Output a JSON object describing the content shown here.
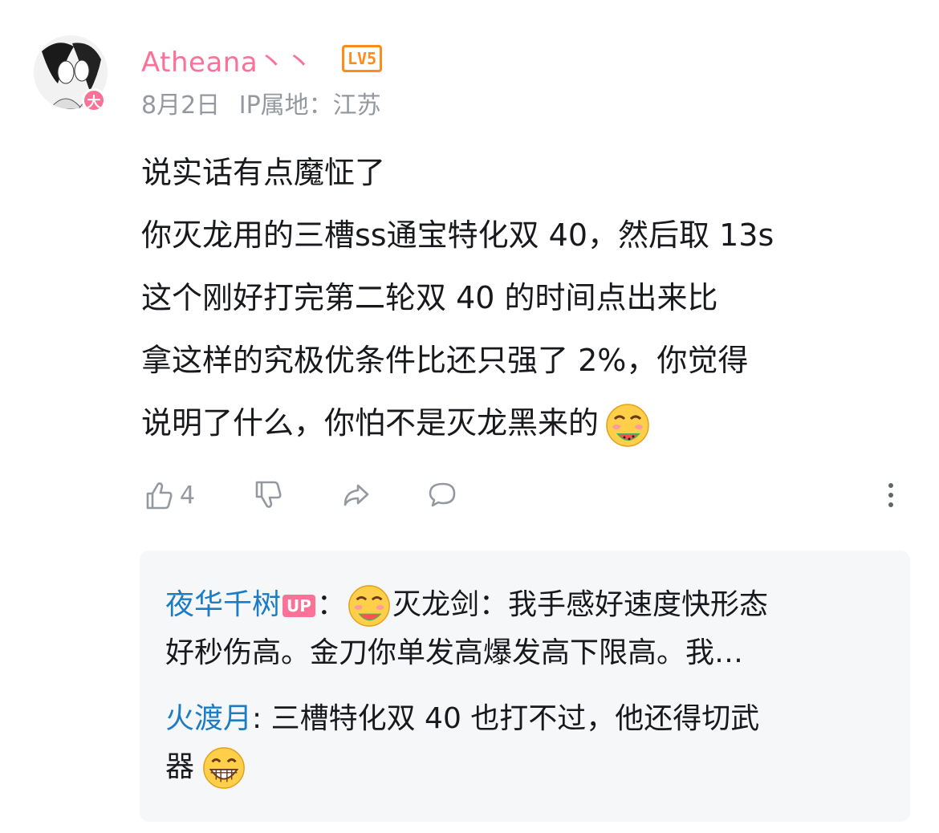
{
  "comment": {
    "user": {
      "name": "Atheana丶丶",
      "level_badge": "LV5",
      "avatar_badge": "大",
      "name_color": "#fb7299"
    },
    "date": "8月2日",
    "ip_location": "IP属地：江苏",
    "body_lines": [
      "说实话有点魔怔了",
      "你灭龙用的三槽ss通宝特化双 40，然后取 13s",
      "这个刚好打完第二轮双 40 的时间点出来比",
      "拿这样的究极优条件比还只强了 2%，你觉得",
      "说明了什么，你怕不是灭龙黑来的"
    ],
    "body_emoji": "watermelon-eating-emoji",
    "actions": {
      "like_count": "4",
      "like_icon": "thumbs-up-icon",
      "dislike_icon": "thumbs-down-icon",
      "share_icon": "share-icon",
      "reply_icon": "comment-bubble-icon",
      "more_icon": "more-vertical-icon"
    }
  },
  "replies": [
    {
      "user": "夜华千树",
      "tag": "UP",
      "separator": "：",
      "emoji": "watermelon-eating-emoji",
      "text_line1": "灭龙剑：我手感好速度快形态",
      "text_line2": "好秒伤高。金刀你单发高爆发高下限高。我…"
    },
    {
      "user": "火渡月",
      "separator": ":",
      "text_line1": " 三槽特化双 40 也打不过，他还得切武",
      "text_line2": "器",
      "emoji": "grinning-emoji"
    }
  ],
  "colors": {
    "accent_pink": "#fb7299",
    "level_orange": "#ff8c1a",
    "link_blue": "#1c7cc4",
    "muted_gray": "#9499a0"
  }
}
